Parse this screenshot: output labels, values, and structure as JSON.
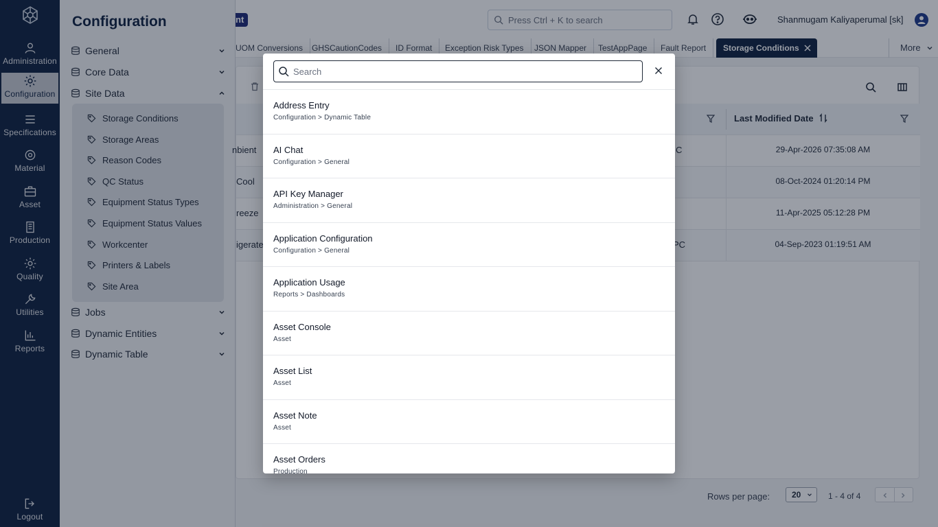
{
  "rail": {
    "items": [
      {
        "label": "Administration"
      },
      {
        "label": "Configuration"
      },
      {
        "label": "Specifications"
      },
      {
        "label": "Material"
      },
      {
        "label": "Asset"
      },
      {
        "label": "Production"
      },
      {
        "label": "Quality"
      },
      {
        "label": "Utilities"
      },
      {
        "label": "Reports"
      }
    ],
    "logout": "Logout"
  },
  "nav": {
    "title": "Configuration",
    "groups": [
      "General",
      "Core Data",
      "Site Data",
      "Jobs",
      "Dynamic Entities",
      "Dynamic Table"
    ],
    "site_data_items": [
      "Storage Conditions",
      "Storage Areas",
      "Reason Codes",
      "QC Status",
      "Equipment Status Types",
      "Equipment Status Values",
      "Workcenter",
      "Printers & Labels",
      "Site Area"
    ]
  },
  "topbar": {
    "env_badge": "nt",
    "search_placeholder": "Press Ctrl + K to search",
    "user": "Shanmugam Kaliyaperumal [sk]"
  },
  "tabs": {
    "items": [
      "UOM Conversions",
      "GHSCautionCodes",
      "ID Format",
      "Exception Risk Types",
      "JSON Mapper",
      "TestAppPage",
      "Fault Report",
      "Storage Conditions"
    ],
    "more": "More"
  },
  "grid": {
    "last_modified_header": "Last Modified Date",
    "rows": [
      {
        "name": "nbient",
        "mid": "C",
        "date": "29-Apr-2026 07:35:08 AM"
      },
      {
        "name": "Cool",
        "mid": "",
        "date": "08-Oct-2024 01:20:14 PM"
      },
      {
        "name": "reeze",
        "mid": "",
        "date": "11-Apr-2025 05:12:28 PM"
      },
      {
        "name": "igerated",
        "mid": "PC",
        "date": "04-Sep-2023 01:19:51 AM"
      }
    ],
    "rows_per_page_label": "Rows per page:",
    "rows_per_page": "20",
    "range": "1 - 4 of 4"
  },
  "modal": {
    "search_placeholder": "Search",
    "results": [
      {
        "title": "Address Entry",
        "path": "Configuration > Dynamic Table"
      },
      {
        "title": "AI Chat",
        "path": "Configuration > General"
      },
      {
        "title": "API Key Manager",
        "path": "Administration > General"
      },
      {
        "title": "Application Configuration",
        "path": "Configuration > General"
      },
      {
        "title": "Application Usage",
        "path": "Reports > Dashboards"
      },
      {
        "title": "Asset Console",
        "path": "Asset"
      },
      {
        "title": "Asset List",
        "path": "Asset"
      },
      {
        "title": "Asset Note",
        "path": "Asset"
      },
      {
        "title": "Asset Orders",
        "path": "Production"
      }
    ]
  }
}
